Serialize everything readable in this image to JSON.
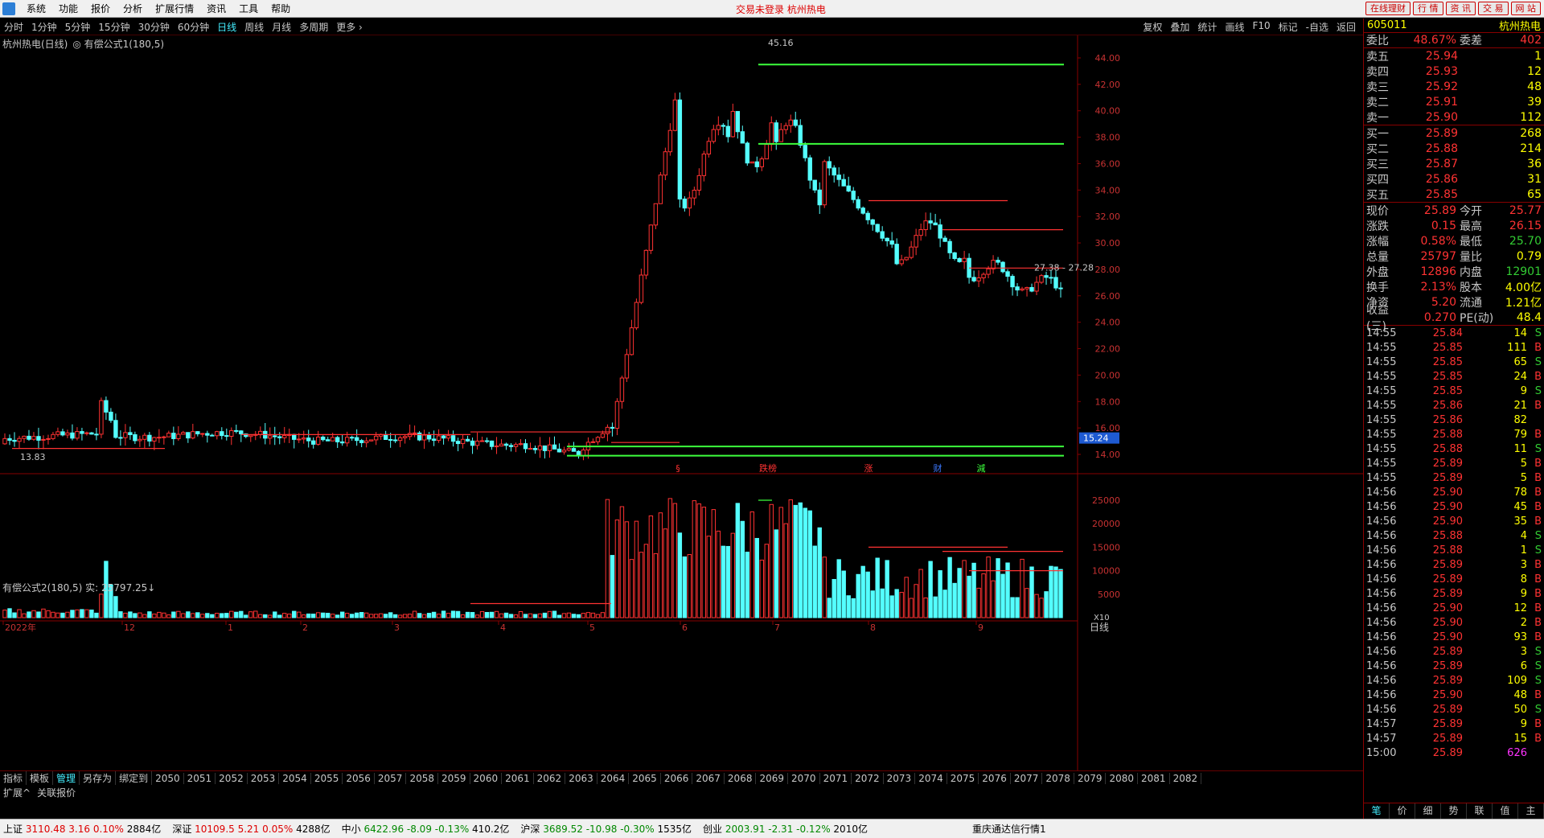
{
  "menubar": {
    "items": [
      "系统",
      "功能",
      "报价",
      "分析",
      "扩展行情",
      "资讯",
      "工具",
      "帮助"
    ],
    "center_text": "交易未登录  杭州热电",
    "right_buttons": [
      "在线理财",
      "行 情",
      "资 讯",
      "交 易",
      "网 站"
    ]
  },
  "periodbar": {
    "periods": [
      "分时",
      "1分钟",
      "5分钟",
      "15分钟",
      "30分钟",
      "60分钟",
      "日线",
      "周线",
      "月线",
      "多周期",
      "更多 ›"
    ],
    "active": "日线",
    "tools": [
      "复权",
      "叠加",
      "统计",
      "画线",
      "F10",
      "标记",
      "-自选",
      "返回"
    ]
  },
  "chart": {
    "title": "杭州热电(日线)",
    "subtitle": "◎ 有偿公式1(180,5)",
    "price_axis": [
      "44.00",
      "42.00",
      "40.00",
      "38.00",
      "36.00",
      "34.00",
      "32.00",
      "30.00",
      "28.00",
      "26.00",
      "24.00",
      "22.00",
      "20.00",
      "18.00",
      "16.00",
      "14.00"
    ],
    "high_label": "45.16",
    "low_label": "13.83",
    "range_label": "27.38 - 27.28",
    "cursor_price": "15.24",
    "event_labels": [
      "§",
      "跌榜",
      "涨",
      "财",
      "減"
    ],
    "vol_title": "有偿公式2(180,5) 实: 25797.25↓",
    "vol_axis": [
      "25000",
      "20000",
      "15000",
      "10000",
      "5000"
    ],
    "vol_unit": "X10",
    "x_labels": [
      "2022年",
      "12",
      "1",
      "2",
      "3",
      "4",
      "5",
      "6",
      "7",
      "8",
      "9"
    ]
  },
  "colors": {
    "up": "#ff3232",
    "down": "#54ffff",
    "green_line": "#3cff3c",
    "red_line": "#ff3232"
  },
  "bottom": {
    "tabs": [
      "指标",
      "模板",
      "管理",
      "另存为",
      "绑定到",
      "2050",
      "2051",
      "2052",
      "2053",
      "2054",
      "2055",
      "2056",
      "2057",
      "2058",
      "2059",
      "2060",
      "2061",
      "2062",
      "2063",
      "2064",
      "2065",
      "2066",
      "2067",
      "2068",
      "2069",
      "2070",
      "2071",
      "2072",
      "2073",
      "2074",
      "2075",
      "2076",
      "2077",
      "2078",
      "2079",
      "2080",
      "2081",
      "2082"
    ],
    "active_tab": "管理",
    "tabs2": [
      "扩展^",
      "关联报价"
    ],
    "period_label": "日线"
  },
  "statusbar": [
    {
      "name": "上证",
      "value": "3110.48",
      "chg": "3.16",
      "pct": "0.10%",
      "amt": "2884亿",
      "dir": "up"
    },
    {
      "name": "深证",
      "value": "10109.5",
      "chg": "5.21",
      "pct": "0.05%",
      "amt": "4288亿",
      "dir": "up"
    },
    {
      "name": "中小",
      "value": "6422.96",
      "chg": "-8.09",
      "pct": "-0.13%",
      "amt": "410.2亿",
      "dir": "down"
    },
    {
      "name": "沪深",
      "value": "3689.52",
      "chg": "-10.98",
      "pct": "-0.30%",
      "amt": "1535亿",
      "dir": "down"
    },
    {
      "name": "创业",
      "value": "2003.91",
      "chg": "-2.31",
      "pct": "-0.12%",
      "amt": "2010亿",
      "dir": "down"
    }
  ],
  "status_right": "重庆通达信行情1",
  "panel": {
    "code": "605011",
    "name": "杭州热电",
    "weibi": {
      "label": "委比",
      "value": "48.67%",
      "label2": "委差",
      "value2": "402"
    },
    "sells": [
      {
        "label": "卖五",
        "price": "25.94",
        "vol": "1"
      },
      {
        "label": "卖四",
        "price": "25.93",
        "vol": "12"
      },
      {
        "label": "卖三",
        "price": "25.92",
        "vol": "48"
      },
      {
        "label": "卖二",
        "price": "25.91",
        "vol": "39"
      },
      {
        "label": "卖一",
        "price": "25.90",
        "vol": "112"
      }
    ],
    "buys": [
      {
        "label": "买一",
        "price": "25.89",
        "vol": "268"
      },
      {
        "label": "买二",
        "price": "25.88",
        "vol": "214"
      },
      {
        "label": "买三",
        "price": "25.87",
        "vol": "36"
      },
      {
        "label": "买四",
        "price": "25.86",
        "vol": "31"
      },
      {
        "label": "买五",
        "price": "25.85",
        "vol": "65"
      }
    ],
    "stats": [
      {
        "a": "现价",
        "b": "25.89",
        "c": "今开",
        "d": "25.77",
        "dc": "#f33"
      },
      {
        "a": "涨跌",
        "b": "0.15",
        "c": "最高",
        "d": "26.15",
        "dc": "#f33"
      },
      {
        "a": "涨幅",
        "b": "0.58%",
        "c": "最低",
        "d": "25.70",
        "dc": "#3c3"
      },
      {
        "a": "总量",
        "b": "25797",
        "c": "量比",
        "d": "0.79",
        "dc": "#ff0"
      },
      {
        "a": "外盘",
        "b": "12896",
        "c": "内盘",
        "d": "12901",
        "dc": "#3c3"
      },
      {
        "a": "换手",
        "b": "2.13%",
        "c": "股本",
        "d": "4.00亿",
        "dc": "#ff0"
      },
      {
        "a": "净资",
        "b": "5.20",
        "c": "流通",
        "d": "1.21亿",
        "dc": "#ff0"
      },
      {
        "a": "收益(三)",
        "b": "0.270",
        "c": "PE(动)",
        "d": "48.4",
        "dc": "#ff0"
      }
    ],
    "ticks": [
      {
        "t": "14:55",
        "p": "25.84",
        "v": "14",
        "bs": "S"
      },
      {
        "t": "14:55",
        "p": "25.85",
        "v": "111",
        "bs": "B"
      },
      {
        "t": "14:55",
        "p": "25.85",
        "v": "65",
        "bs": "S"
      },
      {
        "t": "14:55",
        "p": "25.85",
        "v": "24",
        "bs": "B"
      },
      {
        "t": "14:55",
        "p": "25.85",
        "v": "9",
        "bs": "S"
      },
      {
        "t": "14:55",
        "p": "25.86",
        "v": "21",
        "bs": "B"
      },
      {
        "t": "14:55",
        "p": "25.86",
        "v": "82",
        "bs": ""
      },
      {
        "t": "14:55",
        "p": "25.88",
        "v": "79",
        "bs": "B"
      },
      {
        "t": "14:55",
        "p": "25.88",
        "v": "11",
        "bs": "S"
      },
      {
        "t": "14:55",
        "p": "25.89",
        "v": "5",
        "bs": "B"
      },
      {
        "t": "14:55",
        "p": "25.89",
        "v": "5",
        "bs": "B"
      },
      {
        "t": "14:56",
        "p": "25.90",
        "v": "78",
        "bs": "B"
      },
      {
        "t": "14:56",
        "p": "25.90",
        "v": "45",
        "bs": "B"
      },
      {
        "t": "14:56",
        "p": "25.90",
        "v": "35",
        "bs": "B"
      },
      {
        "t": "14:56",
        "p": "25.88",
        "v": "4",
        "bs": "S"
      },
      {
        "t": "14:56",
        "p": "25.88",
        "v": "1",
        "bs": "S"
      },
      {
        "t": "14:56",
        "p": "25.89",
        "v": "3",
        "bs": "B"
      },
      {
        "t": "14:56",
        "p": "25.89",
        "v": "8",
        "bs": "B"
      },
      {
        "t": "14:56",
        "p": "25.89",
        "v": "9",
        "bs": "B"
      },
      {
        "t": "14:56",
        "p": "25.90",
        "v": "12",
        "bs": "B"
      },
      {
        "t": "14:56",
        "p": "25.90",
        "v": "2",
        "bs": "B"
      },
      {
        "t": "14:56",
        "p": "25.90",
        "v": "93",
        "bs": "B"
      },
      {
        "t": "14:56",
        "p": "25.89",
        "v": "3",
        "bs": "S"
      },
      {
        "t": "14:56",
        "p": "25.89",
        "v": "6",
        "bs": "S"
      },
      {
        "t": "14:56",
        "p": "25.89",
        "v": "109",
        "bs": "S"
      },
      {
        "t": "14:56",
        "p": "25.90",
        "v": "48",
        "bs": "B"
      },
      {
        "t": "14:56",
        "p": "25.89",
        "v": "50",
        "bs": "S"
      },
      {
        "t": "14:57",
        "p": "25.89",
        "v": "9",
        "bs": "B"
      },
      {
        "t": "14:57",
        "p": "25.89",
        "v": "15",
        "bs": "B"
      },
      {
        "t": "15:00",
        "p": "25.89",
        "v": "626",
        "bs": ""
      }
    ],
    "bottom_tabs": [
      "笔",
      "价",
      "细",
      "势",
      "联",
      "值",
      "主"
    ]
  }
}
